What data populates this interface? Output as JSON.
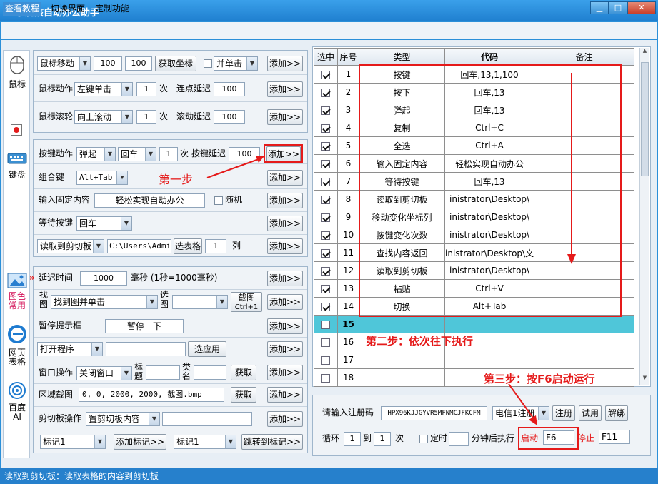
{
  "app": {
    "title": "小屁孩自动办公助手"
  },
  "window": {
    "min": "▁",
    "max": "□",
    "close": "✕"
  },
  "menu": [
    "查看教程",
    "切换界面",
    "定制功能"
  ],
  "sidebar": [
    "鼠标",
    "键盘",
    "图色常用",
    "网页表格",
    "百度AI"
  ],
  "mouse": {
    "move_select": "鼠标移动",
    "x": "100",
    "y": "100",
    "get_coord": "获取坐标",
    "single_click": "并单击",
    "action_label": "鼠标动作",
    "action_select": "左键单击",
    "action_times": "1",
    "times_unit": "次",
    "interval_label": "连点延迟",
    "interval": "100",
    "wheel_label": "鼠标滚轮",
    "wheel_select": "向上滚动",
    "wheel_times": "1",
    "wheel_delay_label": "滚动延迟",
    "wheel_delay": "100",
    "add": "添加>>"
  },
  "keyboard": {
    "action_label": "按键动作",
    "action_select": "弹起",
    "key_select": "回车",
    "times": "1",
    "times_unit": "次",
    "delay_label": "按键延迟",
    "delay": "100",
    "combo_label": "组合键",
    "combo_select": "Alt+Tab",
    "fixed_label": "输入固定内容",
    "fixed_value": "轻松实现自动办公",
    "random": "随机",
    "wait_label": "等待按键",
    "wait_select": "回车",
    "clip_select": "读取到剪切板",
    "clip_path": "C:\\Users\\Admin",
    "pick_table": "选表格",
    "col_num": "1",
    "col_label": "列",
    "add": "添加>>"
  },
  "other": {
    "delay_label": "延迟时间",
    "delay_value": "1000",
    "delay_unit": "毫秒  (1秒=1000毫秒)",
    "find_label1": "找",
    "find_label2": "图",
    "find_select": "找到图并单击",
    "pick_label1": "选",
    "pick_label2": "图",
    "shot_btn1": "截图",
    "shot_btn2": "Ctrl+1",
    "pause_label": "暂停提示框",
    "pause_value": "暂停一下",
    "open_select": "打开程序",
    "choose_app": "选应用",
    "win_label": "窗口操作",
    "win_select": "关闭窗口",
    "title_label1": "标",
    "title_label2": "题",
    "class_label1": "类",
    "class_label2": "名",
    "get": "获取",
    "region_label": "区域截图",
    "region_value": "0, 0, 2000, 2000, 截图.bmp",
    "clip_label": "剪切板操作",
    "clip_select": "置剪切板内容",
    "mark_select": "标记1",
    "add_mark": "添加标记>>",
    "mark_select2": "标记1",
    "jump_mark": "跳转到标记>>",
    "add": "添加>>"
  },
  "table": {
    "headers": [
      "选中",
      "序号",
      "类型",
      "代码",
      "备注"
    ],
    "rows": [
      {
        "checked": true,
        "no": "1",
        "type": "按键",
        "code": "回车,13,1,100"
      },
      {
        "checked": true,
        "no": "2",
        "type": "按下",
        "code": "回车,13"
      },
      {
        "checked": true,
        "no": "3",
        "type": "弹起",
        "code": "回车,13"
      },
      {
        "checked": true,
        "no": "4",
        "type": "复制",
        "code": "Ctrl+C"
      },
      {
        "checked": true,
        "no": "5",
        "type": "全选",
        "code": "Ctrl+A"
      },
      {
        "checked": true,
        "no": "6",
        "type": "输入固定内容",
        "code": "轻松实现自动办公"
      },
      {
        "checked": true,
        "no": "7",
        "type": "等待按键",
        "code": "回车,13"
      },
      {
        "checked": true,
        "no": "8",
        "type": "读取到剪切板",
        "code": "inistrator\\Desktop\\"
      },
      {
        "checked": true,
        "no": "9",
        "type": "移动变化坐标列",
        "code": "inistrator\\Desktop\\"
      },
      {
        "checked": true,
        "no": "10",
        "type": "按键变化次数",
        "code": "inistrator\\Desktop\\"
      },
      {
        "checked": true,
        "no": "11",
        "type": "查找内容返回",
        "code": "inistrator\\Desktop\\文"
      },
      {
        "checked": true,
        "no": "12",
        "type": "读取到剪切板",
        "code": "inistrator\\Desktop\\"
      },
      {
        "checked": true,
        "no": "13",
        "type": "粘贴",
        "code": "Ctrl+V"
      },
      {
        "checked": true,
        "no": "14",
        "type": "切换",
        "code": "Alt+Tab"
      },
      {
        "checked": false,
        "no": "15",
        "type": "",
        "code": ""
      },
      {
        "checked": false,
        "no": "16",
        "type": "",
        "code": ""
      },
      {
        "checked": false,
        "no": "17",
        "type": "",
        "code": ""
      },
      {
        "checked": false,
        "no": "18",
        "type": "",
        "code": ""
      }
    ]
  },
  "bottom": {
    "reg_label": "请输入注册码",
    "reg_code": "HPX96KJJGYVR5MFNMCJFKCFM",
    "carrier": "电信1注册",
    "register": "注册",
    "trial": "试用",
    "unbind": "解绑",
    "loop_label": "循环",
    "loop_from": "1",
    "to_label": "到",
    "loop_to": "1",
    "times_label": "次",
    "timer_label": "定时",
    "after_label": "分钟后执行",
    "start_label": "启动",
    "start_key": "F6",
    "stop_label": "停止",
    "stop_key": "F11"
  },
  "annotations": {
    "step1": "第一步",
    "step2": "第二步：依次往下执行",
    "step3": "第三步：按F6启动运行"
  },
  "status": "读取到剪切板：读取表格的内容到剪切板",
  "colors": {
    "accent": "#2b8fd8",
    "annotation": "#e51a1a",
    "selected_row": "#4fc6d9"
  }
}
